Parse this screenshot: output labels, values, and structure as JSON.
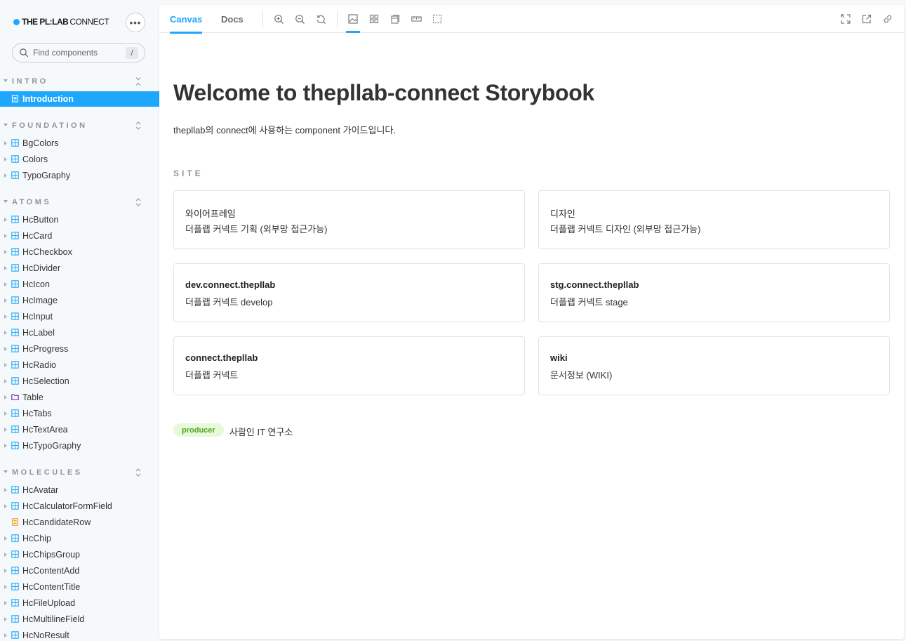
{
  "brand": {
    "bold": "THE PL:LAB",
    "light": "CONNECT",
    "more_label": "•••"
  },
  "search": {
    "placeholder": "Find components",
    "shortcut": "/"
  },
  "sidebar": {
    "sections": [
      {
        "label": "INTRO",
        "toggle_icon": "collapse-icon",
        "items": [
          {
            "label": "Introduction",
            "icon": "document-icon",
            "active": true
          }
        ]
      },
      {
        "label": "FOUNDATION",
        "toggle_icon": "expand-icon",
        "items": [
          {
            "label": "BgColors",
            "icon": "component-icon"
          },
          {
            "label": "Colors",
            "icon": "component-icon"
          },
          {
            "label": "TypoGraphy",
            "icon": "component-icon"
          }
        ]
      },
      {
        "label": "ATOMS",
        "toggle_icon": "expand-icon",
        "items": [
          {
            "label": "HcButton",
            "icon": "component-icon"
          },
          {
            "label": "HcCard",
            "icon": "component-icon"
          },
          {
            "label": "HcCheckbox",
            "icon": "component-icon"
          },
          {
            "label": "HcDivider",
            "icon": "component-icon"
          },
          {
            "label": "HcIcon",
            "icon": "component-icon"
          },
          {
            "label": "HcImage",
            "icon": "component-icon"
          },
          {
            "label": "HcInput",
            "icon": "component-icon"
          },
          {
            "label": "HcLabel",
            "icon": "component-icon"
          },
          {
            "label": "HcProgress",
            "icon": "component-icon"
          },
          {
            "label": "HcRadio",
            "icon": "component-icon"
          },
          {
            "label": "HcSelection",
            "icon": "component-icon"
          },
          {
            "label": "Table",
            "icon": "folder-icon"
          },
          {
            "label": "HcTabs",
            "icon": "component-icon"
          },
          {
            "label": "HcTextArea",
            "icon": "component-icon"
          },
          {
            "label": "HcTypoGraphy",
            "icon": "component-icon"
          }
        ]
      },
      {
        "label": "MOLECULES",
        "toggle_icon": "expand-icon",
        "items": [
          {
            "label": "HcAvatar",
            "icon": "component-icon"
          },
          {
            "label": "HcCalculatorFormField",
            "icon": "component-icon"
          },
          {
            "label": "HcCandidateRow",
            "icon": "story-icon"
          },
          {
            "label": "HcChip",
            "icon": "component-icon"
          },
          {
            "label": "HcChipsGroup",
            "icon": "component-icon"
          },
          {
            "label": "HcContentAdd",
            "icon": "component-icon"
          },
          {
            "label": "HcContentTitle",
            "icon": "component-icon"
          },
          {
            "label": "HcFileUpload",
            "icon": "component-icon"
          },
          {
            "label": "HcMultilineField",
            "icon": "component-icon"
          },
          {
            "label": "HcNoResult",
            "icon": "component-icon"
          }
        ]
      }
    ]
  },
  "toolbar": {
    "tabs": [
      {
        "label": "Canvas",
        "active": true
      },
      {
        "label": "Docs",
        "active": false
      }
    ],
    "left_icons": [
      "zoom-in-icon",
      "zoom-out-icon",
      "reset-zoom-icon"
    ],
    "addon_icons": [
      "background-icon",
      "grid-icon",
      "viewport-icon",
      "measure-icon",
      "outline-icon"
    ],
    "right_icons": [
      "fullscreen-icon",
      "open-new-tab-icon",
      "copy-link-icon"
    ]
  },
  "main": {
    "title": "Welcome to thepllab-connect Storybook",
    "description": "thepllab의 connect에 사용하는 component 가이드입니다.",
    "site_label": "SITE",
    "cards": [
      {
        "title": "와이어프레임",
        "desc": "더플랩 커넥트 기획 (외부망 접근가능)",
        "bold": false
      },
      {
        "title": "디자인",
        "desc": "더플랩 커넥트 디자인 (외부망 접근가능)",
        "bold": false
      },
      {
        "title": "dev.connect.thepllab",
        "desc": "더플랩 커넥트 develop",
        "bold": true
      },
      {
        "title": "stg.connect.thepllab",
        "desc": "더플랩 커넥트 stage",
        "bold": true
      },
      {
        "title": "connect.thepllab",
        "desc": "더플랩 커넥트",
        "bold": true
      },
      {
        "title": "wiki",
        "desc": "문서정보 (WIKI)",
        "bold": true
      }
    ],
    "producer_badge": "producer",
    "producer_name": "사람인 IT 연구소"
  },
  "colors": {
    "accent": "#1ea7fd",
    "sidebar_bg": "#f6f9fc",
    "badge_bg": "#e6f9d8",
    "badge_text": "#56a22a",
    "story_icon": "#f0a030",
    "folder_icon": "#6f2cac"
  }
}
